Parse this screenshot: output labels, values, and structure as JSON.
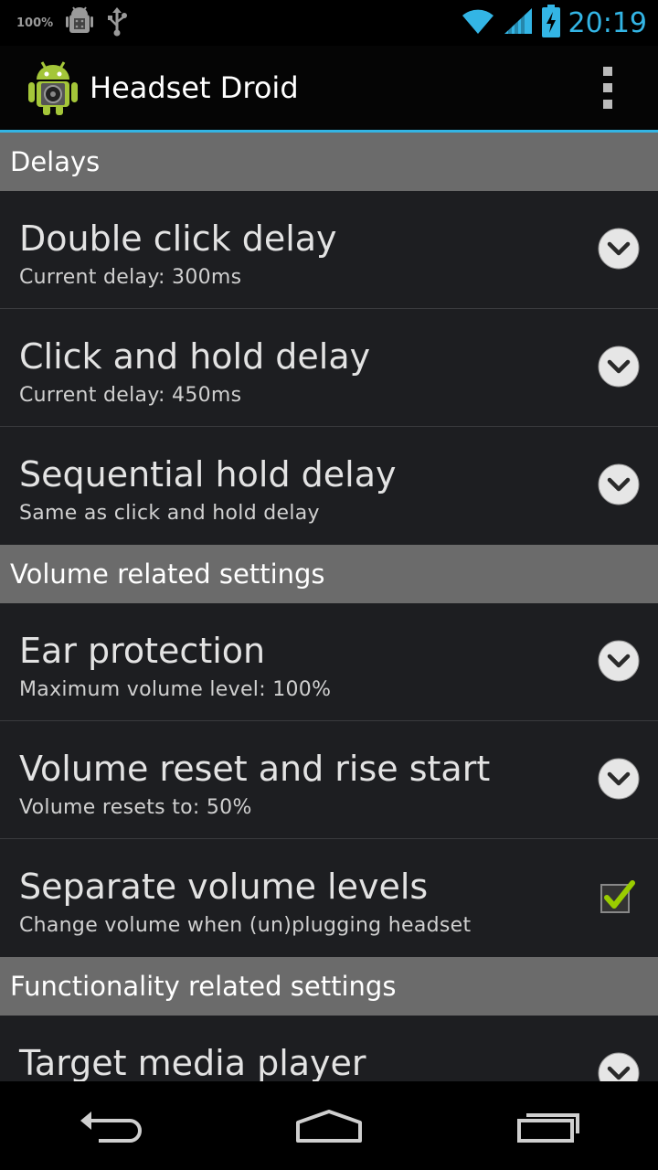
{
  "status_bar": {
    "battery_percent": "100%",
    "time": "20:19",
    "icons": [
      "android-debug-icon",
      "usb-icon",
      "wifi-icon",
      "signal-icon",
      "battery-charging-icon"
    ]
  },
  "action_bar": {
    "title": "Headset Droid",
    "app_icon": "headset-droid-icon",
    "overflow_icon": "overflow-menu-icon"
  },
  "sections": [
    {
      "header": "Delays",
      "items": [
        {
          "title": "Double click delay",
          "summary": "Current delay: 300ms",
          "widget": "dropdown"
        },
        {
          "title": "Click and hold delay",
          "summary": "Current delay: 450ms",
          "widget": "dropdown"
        },
        {
          "title": "Sequential hold delay",
          "summary": "Same as click and hold delay",
          "widget": "dropdown"
        }
      ]
    },
    {
      "header": "Volume related settings",
      "items": [
        {
          "title": "Ear protection",
          "summary": "Maximum volume level: 100%",
          "widget": "dropdown"
        },
        {
          "title": "Volume reset and rise start",
          "summary": "Volume resets to: 50%",
          "widget": "dropdown"
        },
        {
          "title": "Separate volume levels",
          "summary": "Change volume when (un)plugging headset",
          "widget": "checkbox",
          "checked": true
        }
      ]
    },
    {
      "header": "Functionality related settings",
      "items": [
        {
          "title": "Target media player",
          "summary": "",
          "widget": "dropdown"
        }
      ]
    }
  ],
  "nav_bar": {
    "icons": [
      "back-icon",
      "home-icon",
      "recent-apps-icon"
    ]
  },
  "colors": {
    "accent": "#33b5e5",
    "section_header_bg": "#6b6b6b",
    "list_bg": "#1d1e21",
    "checkmark": "#99cc00"
  }
}
